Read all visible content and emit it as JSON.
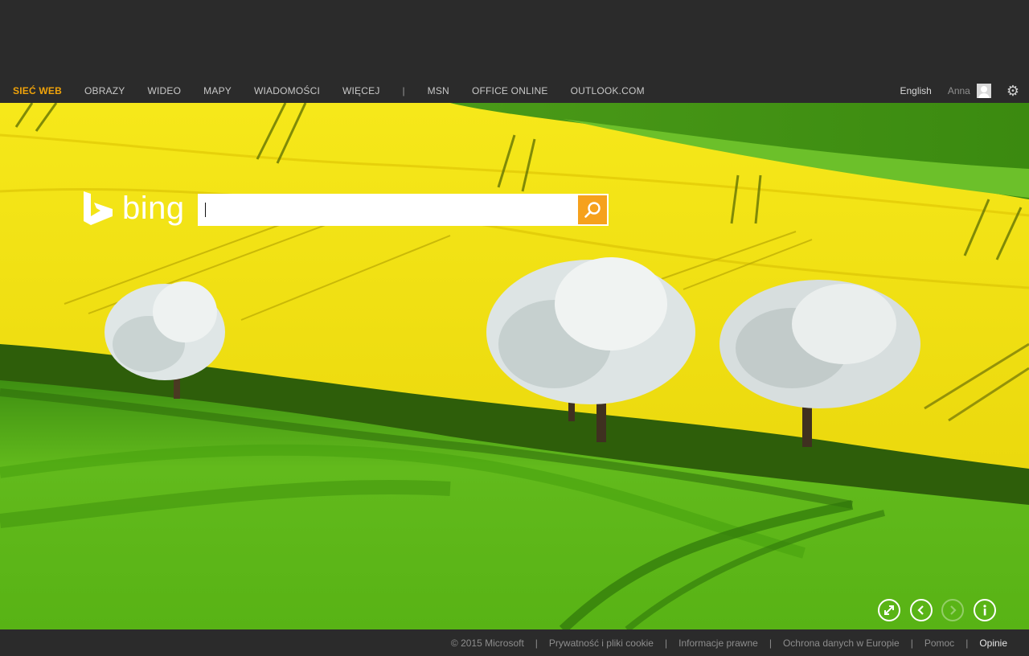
{
  "nav": {
    "left": [
      "SIEĆ WEB",
      "OBRAZY",
      "WIDEO",
      "MAPY",
      "WIADOMOŚCI",
      "WIĘCEJ"
    ],
    "separator": "|",
    "right_links": [
      "MSN",
      "OFFICE ONLINE",
      "OUTLOOK.COM"
    ],
    "active": "SIEĆ WEB",
    "active_color": "#f0a30a"
  },
  "account": {
    "language": "English",
    "user": "Anna",
    "avatar_icon": "user-avatar-icon",
    "settings_icon": "gear-icon"
  },
  "brand": {
    "name": "bing",
    "logo_icon": "bing-b-icon"
  },
  "search": {
    "value": "",
    "button_icon": "search-icon",
    "button_color": "#f6a11c"
  },
  "image_controls": [
    {
      "name": "fullscreen",
      "icon": "expand-icon",
      "enabled": true
    },
    {
      "name": "previous",
      "icon": "chevron-left-icon",
      "enabled": true
    },
    {
      "name": "next",
      "icon": "chevron-right-icon",
      "enabled": false
    },
    {
      "name": "info",
      "icon": "info-icon",
      "enabled": true
    }
  ],
  "footer": {
    "copyright": "© 2015 Microsoft",
    "separator": "|",
    "privacy": "Prywatność i pliki cookie",
    "legal": "Informacje prawne",
    "data_protection": "Ochrona danych w Europie",
    "help": "Pomoc",
    "feedback": "Opinie"
  },
  "colors": {
    "chrome": "#2b2b2b",
    "rapeseed": "#f2e10c",
    "grass": "#5cb51a"
  }
}
